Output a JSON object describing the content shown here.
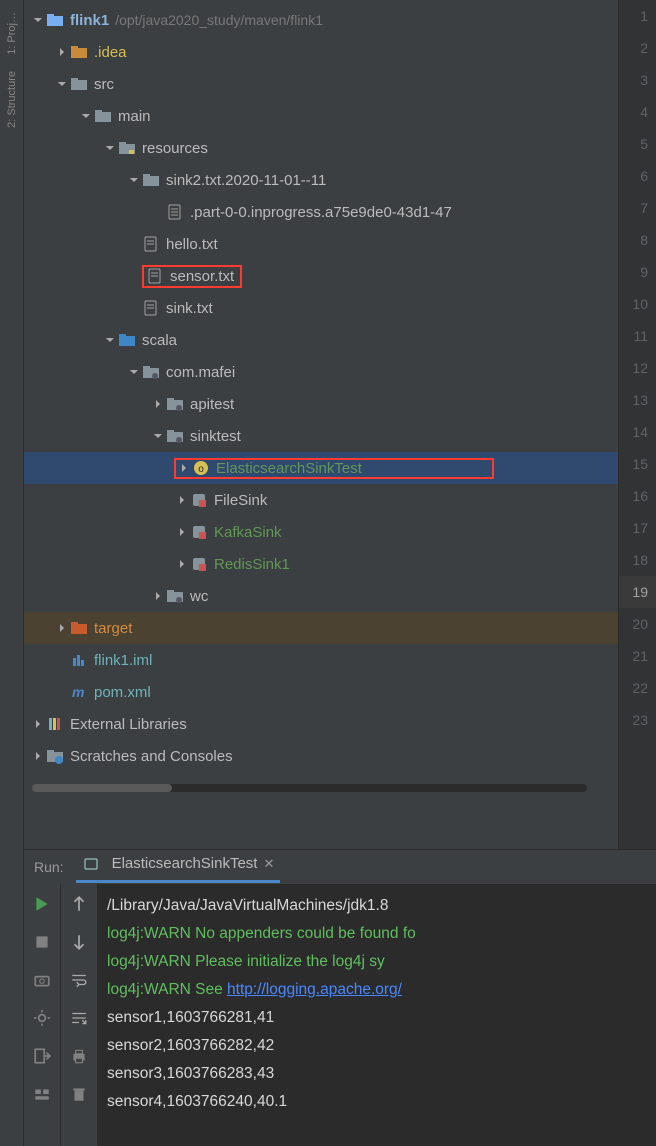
{
  "side_tabs": [
    "1: Proj…",
    "2: Structure"
  ],
  "project": {
    "name": "flink1",
    "path": "/opt/java2020_study/maven/flink1"
  },
  "tree": {
    "idea": ".idea",
    "src": "src",
    "main": "main",
    "resources": "resources",
    "sink2dir": "sink2.txt.2020-11-01--11",
    "partfile": ".part-0-0.inprogress.a75e9de0-43d1-47",
    "hello": "hello.txt",
    "sensor": "sensor.txt",
    "sink": "sink.txt",
    "scala": "scala",
    "pkg": "com.mafei",
    "apitest": "apitest",
    "sinktest": "sinktest",
    "es": "ElasticsearchSinkTest",
    "filesink": "FileSink",
    "kafkasink": "KafkaSink",
    "redissink": "RedisSink1",
    "wc": "wc",
    "target": "target",
    "iml": "flink1.iml",
    "pom": "pom.xml",
    "extlib": "External Libraries",
    "scratches": "Scratches and Consoles"
  },
  "gutter": {
    "count": 23,
    "highlight": 19
  },
  "run": {
    "label": "Run:",
    "tab": "ElasticsearchSinkTest",
    "lines": [
      {
        "cls": "c-white",
        "text": "/Library/Java/JavaVirtualMachines/jdk1.8"
      },
      {
        "cls": "c-green",
        "text": "log4j:WARN No appenders could be found fo"
      },
      {
        "cls": "c-green",
        "prefix": "log4j:WARN Please initialize the log4j sy"
      },
      {
        "cls": "c-green",
        "prefix": "log4j:WARN See ",
        "link": "http://logging.apache.org/"
      },
      {
        "cls": "c-white",
        "text": "sensor1,1603766281,41"
      },
      {
        "cls": "c-white",
        "text": "sensor2,1603766282,42"
      },
      {
        "cls": "c-white",
        "text": "sensor3,1603766283,43"
      },
      {
        "cls": "c-white",
        "text": "sensor4,1603766240,40.1"
      }
    ]
  }
}
